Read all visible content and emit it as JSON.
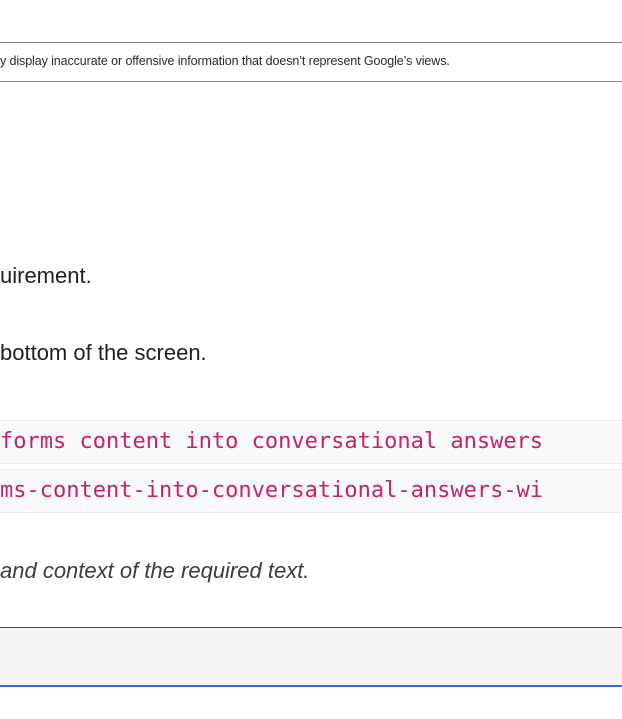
{
  "disclaimer": {
    "text": "y display inaccurate or offensive information that doesn’t represent Google’s views."
  },
  "content": {
    "line1": "uirement.",
    "line2": "bottom of the screen.",
    "code_line1": "forms content into conversational answers",
    "code_line2": "ms-content-into-conversational-answers-wi",
    "note": "and context of the required text."
  },
  "colors": {
    "code_text": "#c5226e",
    "focus_border": "#2f6fde"
  }
}
